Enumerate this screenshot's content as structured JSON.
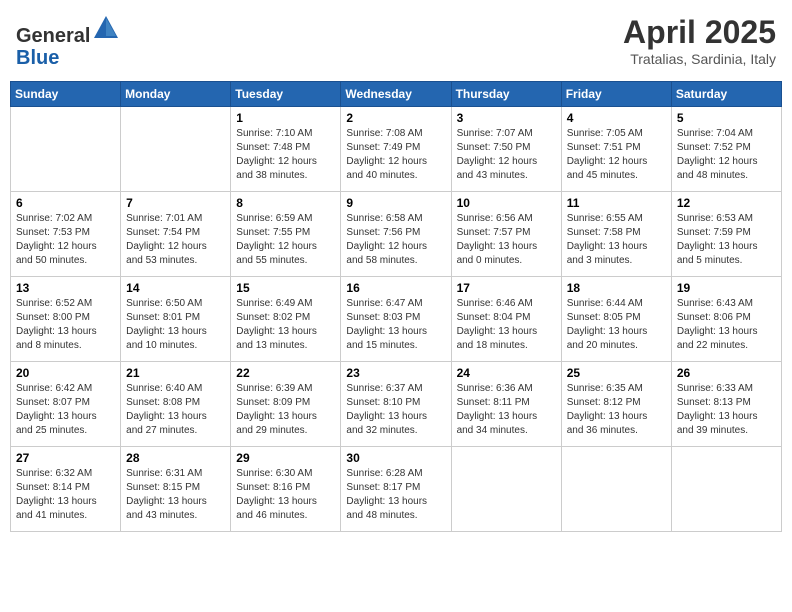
{
  "header": {
    "logo_line1": "General",
    "logo_line2": "Blue",
    "month_title": "April 2025",
    "subtitle": "Tratalias, Sardinia, Italy"
  },
  "weekdays": [
    "Sunday",
    "Monday",
    "Tuesday",
    "Wednesday",
    "Thursday",
    "Friday",
    "Saturday"
  ],
  "weeks": [
    [
      {
        "day": "",
        "info": ""
      },
      {
        "day": "",
        "info": ""
      },
      {
        "day": "1",
        "info": "Sunrise: 7:10 AM\nSunset: 7:48 PM\nDaylight: 12 hours and 38 minutes."
      },
      {
        "day": "2",
        "info": "Sunrise: 7:08 AM\nSunset: 7:49 PM\nDaylight: 12 hours and 40 minutes."
      },
      {
        "day": "3",
        "info": "Sunrise: 7:07 AM\nSunset: 7:50 PM\nDaylight: 12 hours and 43 minutes."
      },
      {
        "day": "4",
        "info": "Sunrise: 7:05 AM\nSunset: 7:51 PM\nDaylight: 12 hours and 45 minutes."
      },
      {
        "day": "5",
        "info": "Sunrise: 7:04 AM\nSunset: 7:52 PM\nDaylight: 12 hours and 48 minutes."
      }
    ],
    [
      {
        "day": "6",
        "info": "Sunrise: 7:02 AM\nSunset: 7:53 PM\nDaylight: 12 hours and 50 minutes."
      },
      {
        "day": "7",
        "info": "Sunrise: 7:01 AM\nSunset: 7:54 PM\nDaylight: 12 hours and 53 minutes."
      },
      {
        "day": "8",
        "info": "Sunrise: 6:59 AM\nSunset: 7:55 PM\nDaylight: 12 hours and 55 minutes."
      },
      {
        "day": "9",
        "info": "Sunrise: 6:58 AM\nSunset: 7:56 PM\nDaylight: 12 hours and 58 minutes."
      },
      {
        "day": "10",
        "info": "Sunrise: 6:56 AM\nSunset: 7:57 PM\nDaylight: 13 hours and 0 minutes."
      },
      {
        "day": "11",
        "info": "Sunrise: 6:55 AM\nSunset: 7:58 PM\nDaylight: 13 hours and 3 minutes."
      },
      {
        "day": "12",
        "info": "Sunrise: 6:53 AM\nSunset: 7:59 PM\nDaylight: 13 hours and 5 minutes."
      }
    ],
    [
      {
        "day": "13",
        "info": "Sunrise: 6:52 AM\nSunset: 8:00 PM\nDaylight: 13 hours and 8 minutes."
      },
      {
        "day": "14",
        "info": "Sunrise: 6:50 AM\nSunset: 8:01 PM\nDaylight: 13 hours and 10 minutes."
      },
      {
        "day": "15",
        "info": "Sunrise: 6:49 AM\nSunset: 8:02 PM\nDaylight: 13 hours and 13 minutes."
      },
      {
        "day": "16",
        "info": "Sunrise: 6:47 AM\nSunset: 8:03 PM\nDaylight: 13 hours and 15 minutes."
      },
      {
        "day": "17",
        "info": "Sunrise: 6:46 AM\nSunset: 8:04 PM\nDaylight: 13 hours and 18 minutes."
      },
      {
        "day": "18",
        "info": "Sunrise: 6:44 AM\nSunset: 8:05 PM\nDaylight: 13 hours and 20 minutes."
      },
      {
        "day": "19",
        "info": "Sunrise: 6:43 AM\nSunset: 8:06 PM\nDaylight: 13 hours and 22 minutes."
      }
    ],
    [
      {
        "day": "20",
        "info": "Sunrise: 6:42 AM\nSunset: 8:07 PM\nDaylight: 13 hours and 25 minutes."
      },
      {
        "day": "21",
        "info": "Sunrise: 6:40 AM\nSunset: 8:08 PM\nDaylight: 13 hours and 27 minutes."
      },
      {
        "day": "22",
        "info": "Sunrise: 6:39 AM\nSunset: 8:09 PM\nDaylight: 13 hours and 29 minutes."
      },
      {
        "day": "23",
        "info": "Sunrise: 6:37 AM\nSunset: 8:10 PM\nDaylight: 13 hours and 32 minutes."
      },
      {
        "day": "24",
        "info": "Sunrise: 6:36 AM\nSunset: 8:11 PM\nDaylight: 13 hours and 34 minutes."
      },
      {
        "day": "25",
        "info": "Sunrise: 6:35 AM\nSunset: 8:12 PM\nDaylight: 13 hours and 36 minutes."
      },
      {
        "day": "26",
        "info": "Sunrise: 6:33 AM\nSunset: 8:13 PM\nDaylight: 13 hours and 39 minutes."
      }
    ],
    [
      {
        "day": "27",
        "info": "Sunrise: 6:32 AM\nSunset: 8:14 PM\nDaylight: 13 hours and 41 minutes."
      },
      {
        "day": "28",
        "info": "Sunrise: 6:31 AM\nSunset: 8:15 PM\nDaylight: 13 hours and 43 minutes."
      },
      {
        "day": "29",
        "info": "Sunrise: 6:30 AM\nSunset: 8:16 PM\nDaylight: 13 hours and 46 minutes."
      },
      {
        "day": "30",
        "info": "Sunrise: 6:28 AM\nSunset: 8:17 PM\nDaylight: 13 hours and 48 minutes."
      },
      {
        "day": "",
        "info": ""
      },
      {
        "day": "",
        "info": ""
      },
      {
        "day": "",
        "info": ""
      }
    ]
  ]
}
